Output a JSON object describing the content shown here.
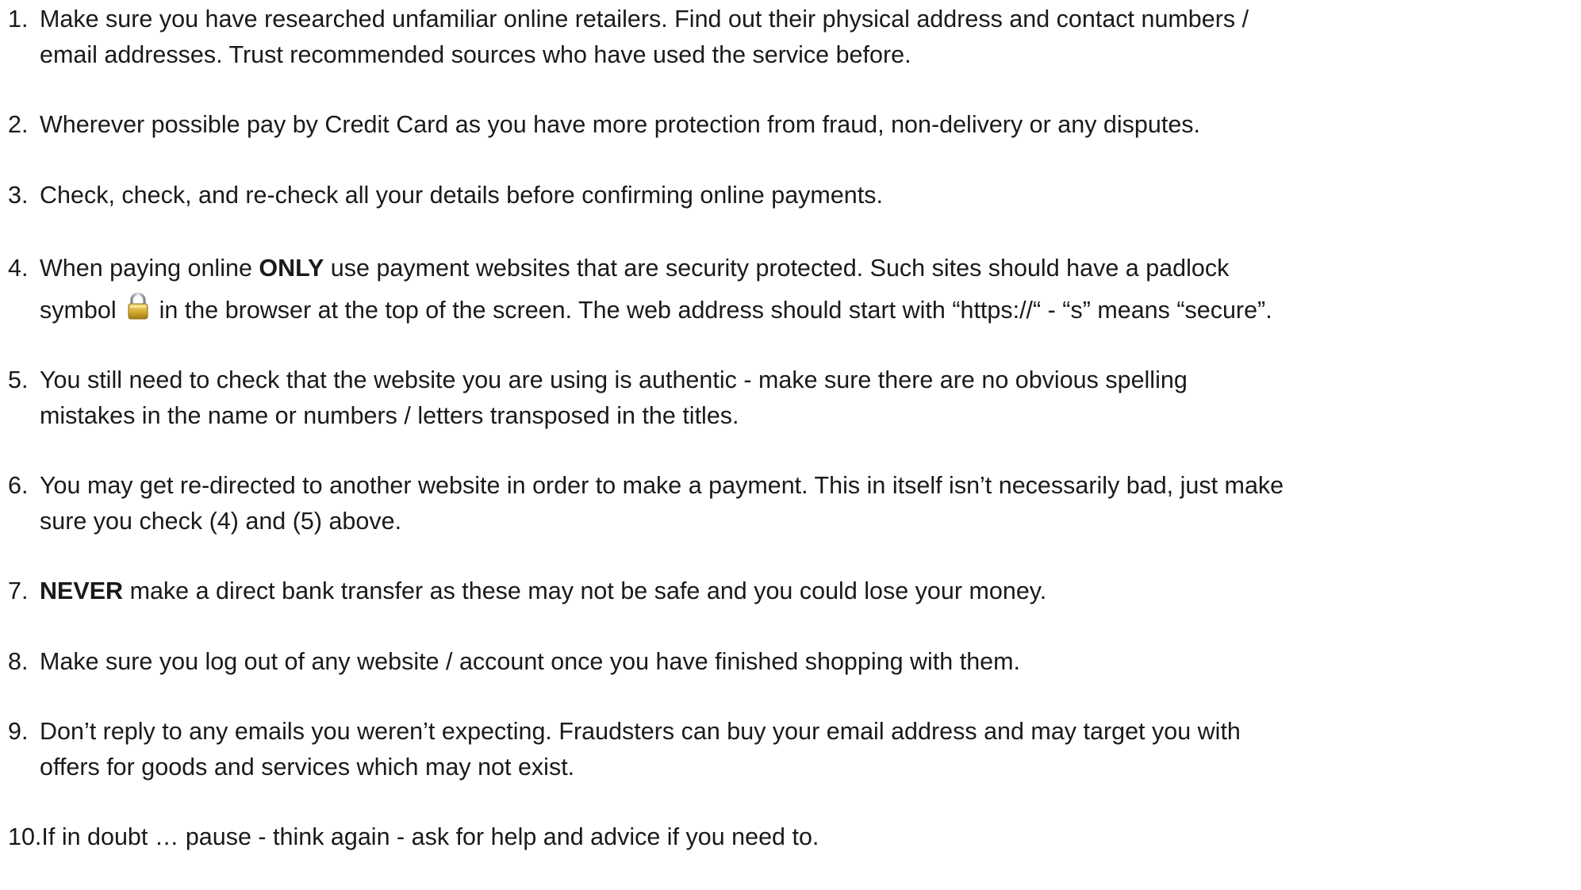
{
  "tips": [
    {
      "number": "1.",
      "line1": "Make sure you have researched unfamiliar online retailers. Find out their physical address and contact numbers /",
      "line2": "email addresses. Trust recommended sources who have used the service before."
    },
    {
      "number": "2.",
      "line1": "Wherever possible pay by Credit Card as you have more protection from fraud, non-delivery or any disputes."
    },
    {
      "number": "3.",
      "line1": "Check, check, and re-check all your details before confirming online payments."
    },
    {
      "number": "4.",
      "line1_pre": "When paying online ",
      "line1_bold": "ONLY",
      "line1_post": " use payment websites that are security protected. Such sites should have a padlock",
      "line2_pre": "symbol",
      "line2_post": "in the browser at the top of the screen. The web address should start with “https://“ - “s” means “secure”.",
      "icon": "padlock-icon"
    },
    {
      "number": "5.",
      "line1": "You still need to check that the website you are using is authentic - make sure there are no obvious spelling",
      "line2": "mistakes in the name or numbers / letters transposed in the titles."
    },
    {
      "number": "6.",
      "line1": "You may get re-directed to another website in order to make a payment. This in itself isn’t necessarily bad, just make",
      "line2": "sure you check (4) and (5) above."
    },
    {
      "number": "7.",
      "bold": "NEVER",
      "rest": " make a direct bank transfer as these may not be safe and you could lose your money."
    },
    {
      "number": "8.",
      "line1": "Make sure you log out of any website / account once you have finished shopping with them."
    },
    {
      "number": "9.",
      "line1": "Don’t reply to any emails you weren’t expecting. Fraudsters can buy your email address and may target you with",
      "line2": "offers for goods and services which may not exist."
    },
    {
      "number": "10.",
      "line1": "If in doubt … pause - think again - ask for help and advice if you need to."
    }
  ],
  "colors": {
    "text": "#1a1a1a",
    "background": "#ffffff",
    "padlock_body": "#c9a227",
    "padlock_shackle": "#9aa3ad"
  }
}
